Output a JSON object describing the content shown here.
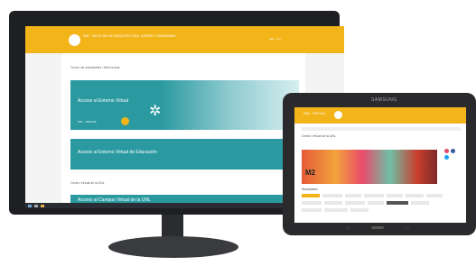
{
  "monitor": {
    "header": {
      "logo_text": "UNL · FACULTAD DE ARQUITECTURA, DISEÑO Y URBANISMO",
      "right_text": "fadu · unl"
    },
    "section_label_1": "Centro de estudiantes / Bienvenida",
    "banner1_title": "Acceso al Entorno Virtual",
    "banner1_tag": "UNL · VIRTUAL",
    "banner2_title": "Acceso al Entorno Virtual de Educación",
    "section_label_2": "Centro Virtual de la UNL",
    "banner3_title": "Acceso al Campus Virtual de la UNL"
  },
  "tablet": {
    "brand": "SAMSUNG",
    "header_logo": "UNL · VIRTUAL",
    "title": "Centro Virtual de la UNL",
    "photo_overlay": "M2",
    "section": "Novedades",
    "colors": {
      "accent": "#f2b418",
      "teal": "#2a9aa0",
      "social1": "#e64b6b",
      "social2": "#3b5998",
      "social3": "#1da1f2"
    }
  },
  "icons": [
    "cursor-icon",
    "windows-start-icon",
    "back-icon",
    "home-icon",
    "recent-apps-icon"
  ]
}
